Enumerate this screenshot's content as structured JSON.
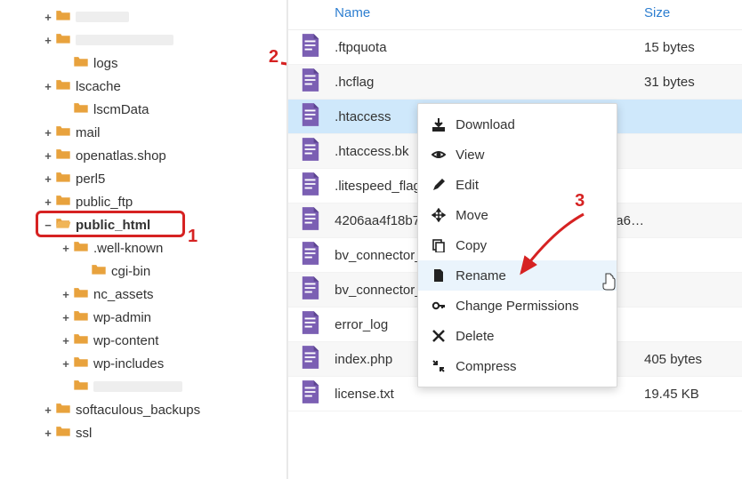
{
  "header": {
    "name": "Name",
    "size": "Size"
  },
  "tree": {
    "items": [
      {
        "label": "",
        "toggle": "+",
        "depth": 0,
        "ghost": 60
      },
      {
        "label": "",
        "toggle": "+",
        "depth": 0,
        "ghost": 110
      },
      {
        "label": "logs",
        "toggle": "",
        "depth": 1
      },
      {
        "label": "lscache",
        "toggle": "+",
        "depth": 0
      },
      {
        "label": "lscmData",
        "toggle": "",
        "depth": 1
      },
      {
        "label": "mail",
        "toggle": "+",
        "depth": 0
      },
      {
        "label": "openatlas.shop",
        "toggle": "+",
        "depth": 0
      },
      {
        "label": "perl5",
        "toggle": "+",
        "depth": 0
      },
      {
        "label": "public_ftp",
        "toggle": "+",
        "depth": 0
      },
      {
        "label": "public_html",
        "toggle": "−",
        "depth": 0,
        "open": true,
        "bold": true,
        "highlight": true
      },
      {
        "label": ".well-known",
        "toggle": "+",
        "depth": 1
      },
      {
        "label": "cgi-bin",
        "toggle": "",
        "depth": 2
      },
      {
        "label": "nc_assets",
        "toggle": "+",
        "depth": 1
      },
      {
        "label": "wp-admin",
        "toggle": "+",
        "depth": 1
      },
      {
        "label": "wp-content",
        "toggle": "+",
        "depth": 1
      },
      {
        "label": "wp-includes",
        "toggle": "+",
        "depth": 1
      },
      {
        "label": "",
        "toggle": "",
        "depth": 1,
        "ghost": 100
      },
      {
        "label": "softaculous_backups",
        "toggle": "+",
        "depth": 0
      },
      {
        "label": "ssl",
        "toggle": "+",
        "depth": 0
      }
    ]
  },
  "files": [
    {
      "name": ".ftpquota",
      "size": "15 bytes",
      "dim": false
    },
    {
      "name": ".hcflag",
      "size": "31 bytes",
      "dim": true
    },
    {
      "name": ".htaccess",
      "size": "",
      "dim": false,
      "selected": true
    },
    {
      "name": ".htaccess.bk",
      "size": "",
      "dim": true
    },
    {
      "name": ".litespeed_flag",
      "size": "",
      "dim": false
    },
    {
      "name": "4206aa4f18b73d6f2b628baf23a16d7de06f4c38a6…",
      "size": "",
      "dim": true
    },
    {
      "name": "bv_connector_4327e48048…",
      "size": "",
      "dim": false
    },
    {
      "name": "bv_connector_83ac0023f3…",
      "size": "",
      "dim": true
    },
    {
      "name": "error_log",
      "size": "",
      "dim": false
    },
    {
      "name": "index.php",
      "size": "405 bytes",
      "dim": true
    },
    {
      "name": "license.txt",
      "size": "19.45 KB",
      "dim": false
    }
  ],
  "context_menu": {
    "items": [
      {
        "label": "Download",
        "icon": "download"
      },
      {
        "label": "View",
        "icon": "eye"
      },
      {
        "label": "Edit",
        "icon": "pencil"
      },
      {
        "label": "Move",
        "icon": "move"
      },
      {
        "label": "Copy",
        "icon": "copy"
      },
      {
        "label": "Rename",
        "icon": "file",
        "hover": true
      },
      {
        "label": "Change Permissions",
        "icon": "key"
      },
      {
        "label": "Delete",
        "icon": "close"
      },
      {
        "label": "Compress",
        "icon": "compress"
      }
    ]
  },
  "annotations": {
    "a1": "1",
    "a2": "2",
    "a3": "3"
  }
}
